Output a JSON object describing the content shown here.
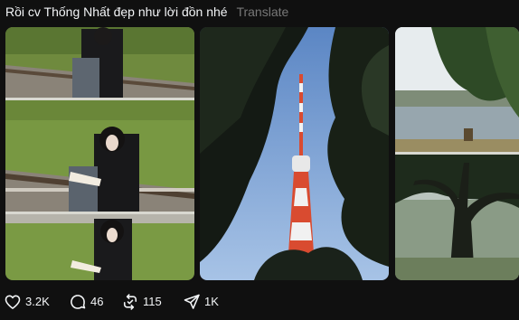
{
  "post": {
    "caption": "Rồi cv Thống Nhất đẹp như lời đồn nhé",
    "translate_label": "Translate"
  },
  "photos": [
    {
      "name": "photo-girl-reading-by-railway"
    },
    {
      "name": "photo-tv-tower-through-trees"
    },
    {
      "name": "photo-lake-and-trees"
    }
  ],
  "actions": {
    "like": {
      "count": "3.2K",
      "icon": "heart-icon"
    },
    "comment": {
      "count": "46",
      "icon": "comment-icon"
    },
    "repost": {
      "count": "115",
      "icon": "repost-icon"
    },
    "share": {
      "count": "1K",
      "icon": "send-icon"
    }
  },
  "colors": {
    "background": "#101010",
    "text": "#f3f5f7",
    "muted": "#777777"
  }
}
